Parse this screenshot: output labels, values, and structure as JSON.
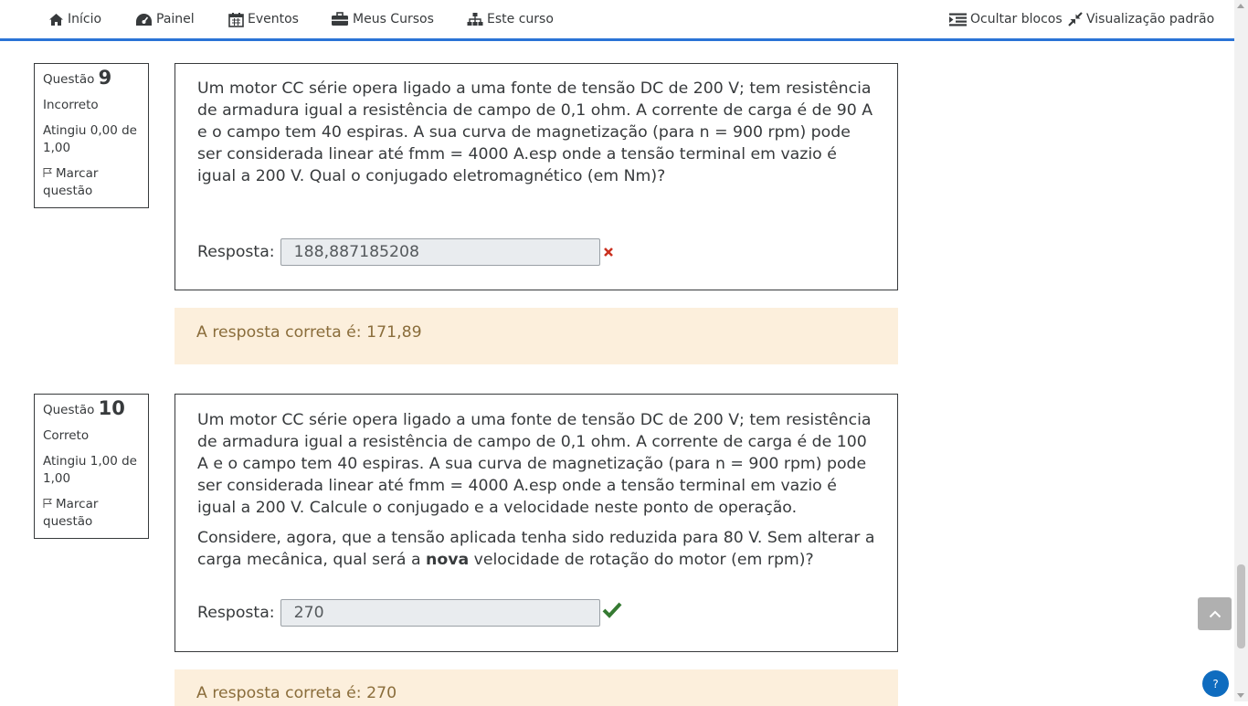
{
  "navbar": {
    "items": [
      {
        "label": "Início",
        "icon": "home-icon"
      },
      {
        "label": "Painel",
        "icon": "dashboard-icon"
      },
      {
        "label": "Eventos",
        "icon": "calendar-icon"
      },
      {
        "label": "Meus Cursos",
        "icon": "briefcase-icon"
      },
      {
        "label": "Este curso",
        "icon": "sitemap-icon"
      }
    ],
    "right": [
      {
        "label": "Ocultar blocos",
        "icon": "indent-icon"
      },
      {
        "label": "Visualização padrão",
        "icon": "compress-icon"
      }
    ],
    "accent_color": "#2a73d6"
  },
  "questions": [
    {
      "label": "Questão",
      "number": "9",
      "status": "Incorreto",
      "grade": "Atingiu 0,00 de 1,00",
      "flag_label": "Marcar questão",
      "text": [
        "Um motor CC série opera ligado a uma fonte de tensão DC de 200 V; tem resistência de armadura igual a resistência de campo de 0,1 ohm. A corrente de carga é de 90 A e o campo tem 40 espiras. A sua curva de magnetização (para n = 900 rpm) pode ser considerada linear até fmm = 4000 A.esp onde a tensão terminal em vazio é igual a 200 V. Qual o conjugado eletromagnético (em Nm)?"
      ],
      "answer_label": "Resposta:",
      "answer_value": "188,887185208",
      "result_icon": "cross-icon",
      "feedback": "A resposta correta é: 171,89"
    },
    {
      "label": "Questão",
      "number": "10",
      "status": "Correto",
      "grade": "Atingiu 1,00 de 1,00",
      "flag_label": "Marcar questão",
      "text": [
        "Um motor CC série opera ligado a uma fonte de tensão DC de 200 V; tem resistência de armadura igual a resistência de campo de 0,1 ohm. A corrente de carga é de 100 A e o campo tem 40 espiras. A sua curva de magnetização (para n = 900 rpm) pode ser considerada linear até fmm = 4000 A.esp onde a tensão terminal em vazio é igual a 200 V. Calcule o conjugado e a velocidade neste ponto de operação.",
        "Considere, agora, que a tensão aplicada tenha sido reduzida para 80 V. Sem alterar a carga mecânica, qual será a "
      ],
      "text_bold": "nova",
      "text_tail": " velocidade de rotação do motor (em rpm)?",
      "answer_label": "Resposta:",
      "answer_value": "270",
      "result_icon": "check-icon",
      "feedback": "A resposta correta é: 270"
    }
  ],
  "help_label": "?",
  "colors": {
    "incorrect": "#ca3120",
    "correct": "#357a32",
    "feedback_bg": "#fcefdc"
  }
}
